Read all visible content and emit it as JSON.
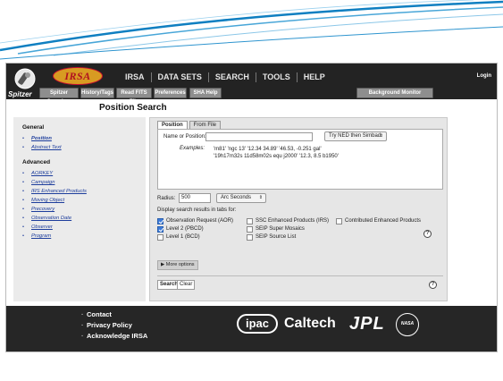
{
  "header": {
    "logo_text": "IRSA",
    "nav": [
      "IRSA",
      "DATA SETS",
      "SEARCH",
      "TOOLS",
      "HELP"
    ],
    "login": "Login"
  },
  "toolbar": {
    "mission_label": "Spitzer",
    "buttons": [
      "Spitzer Searches",
      "History/Tags",
      "Read FITS File",
      "Preferences",
      "SHA Help",
      "Background Monitor"
    ]
  },
  "page": {
    "title": "Position Search"
  },
  "sidebar": {
    "general_heading": "General",
    "general_items": [
      {
        "label": "Position",
        "active": true
      },
      {
        "label": "Abstract Text",
        "active": false
      }
    ],
    "advanced_heading": "Advanced",
    "advanced_items": [
      "AORKEY",
      "Campaign",
      "IRS Enhanced Products",
      "Moving Object",
      "Precovery",
      "Observation Date",
      "Observer",
      "Program"
    ]
  },
  "form": {
    "tabs": [
      "Position",
      "From File"
    ],
    "name_label": "Name or Position:",
    "name_value": "",
    "resolver": "Try NED then Simbad",
    "examples_label": "Examples:",
    "examples_line1": "'m81'   'ngc 13'   '12.34 34.89'   '46.53, -0.251 gal'",
    "examples_line2": "'19h17m32s 11d58m02s equ j2000'   '12.3, 8.5 b1950'",
    "radius_label": "Radius:",
    "radius_value": "500",
    "radius_unit": "Arc Seconds",
    "display_label": "Display search results in tabs for:",
    "checkboxes": [
      {
        "label": "Observation Request (AOR)",
        "checked": true
      },
      {
        "label": "Level 2 (PBCD)",
        "checked": true
      },
      {
        "label": "Level 1 (BCD)",
        "checked": false
      },
      {
        "label": "SSC Enhanced Products (IRS)",
        "checked": false
      },
      {
        "label": "SEIP Super Mosaics",
        "checked": false
      },
      {
        "label": "SEIP Source List",
        "checked": false
      },
      {
        "label": "Contributed Enhanced Products",
        "checked": false
      }
    ],
    "more_options": "More options",
    "search_button": "Search",
    "clear_button": "Clear",
    "help_glyph": "?"
  },
  "footer": {
    "links": [
      "Contact",
      "Privacy Policy",
      "Acknowledge IRSA"
    ],
    "logos": [
      "ipac",
      "Caltech",
      "JPL",
      "NASA"
    ]
  },
  "colors": {
    "header_bg": "#232323",
    "link_blue": "#1d3d9c",
    "panel_gray": "#e6e6e6",
    "checkbox_blue": "#3d7bd9",
    "deco_blue": "#0f7fc1"
  }
}
